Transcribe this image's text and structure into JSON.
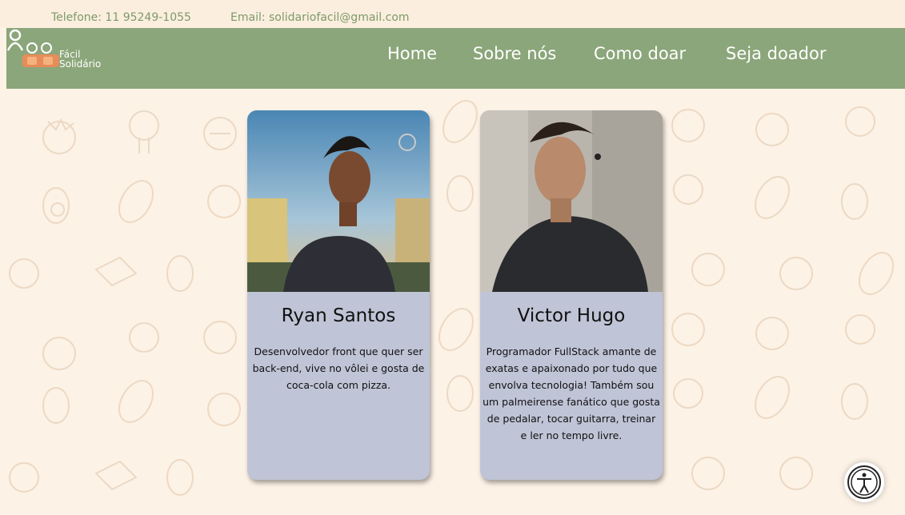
{
  "topbar": {
    "phone": "Telefone: 11 95249-1055",
    "email": "Email: solidariofacil@gmail.com"
  },
  "brand": {
    "line1": "Fácil",
    "line2": "Solidário"
  },
  "nav": {
    "home": "Home",
    "about": "Sobre nós",
    "how_to_donate": "Como doar",
    "become_donor": "Seja doador"
  },
  "team": [
    {
      "name": "Ryan Santos",
      "bio": "Desenvolvedor front que quer ser back-end, vive no vôlei e gosta de coca-cola com pizza."
    },
    {
      "name": "Victor Hugo",
      "bio": "Programador FullStack amante de exatas e apaixonado por tudo que envolva tecnologia! Também sou um palmeirense fanático que gosta de pedalar, tocar guitarra, treinar e ler no tempo livre."
    }
  ],
  "colors": {
    "nav_green": "#8ba67a",
    "card_bg": "#bfc4d6",
    "page_bg": "#fdf2e6",
    "topbar_text": "#7d9a6a"
  },
  "icons": {
    "user": "user-icon",
    "accessibility": "accessibility-icon",
    "logo": "hands-heart-logo"
  }
}
